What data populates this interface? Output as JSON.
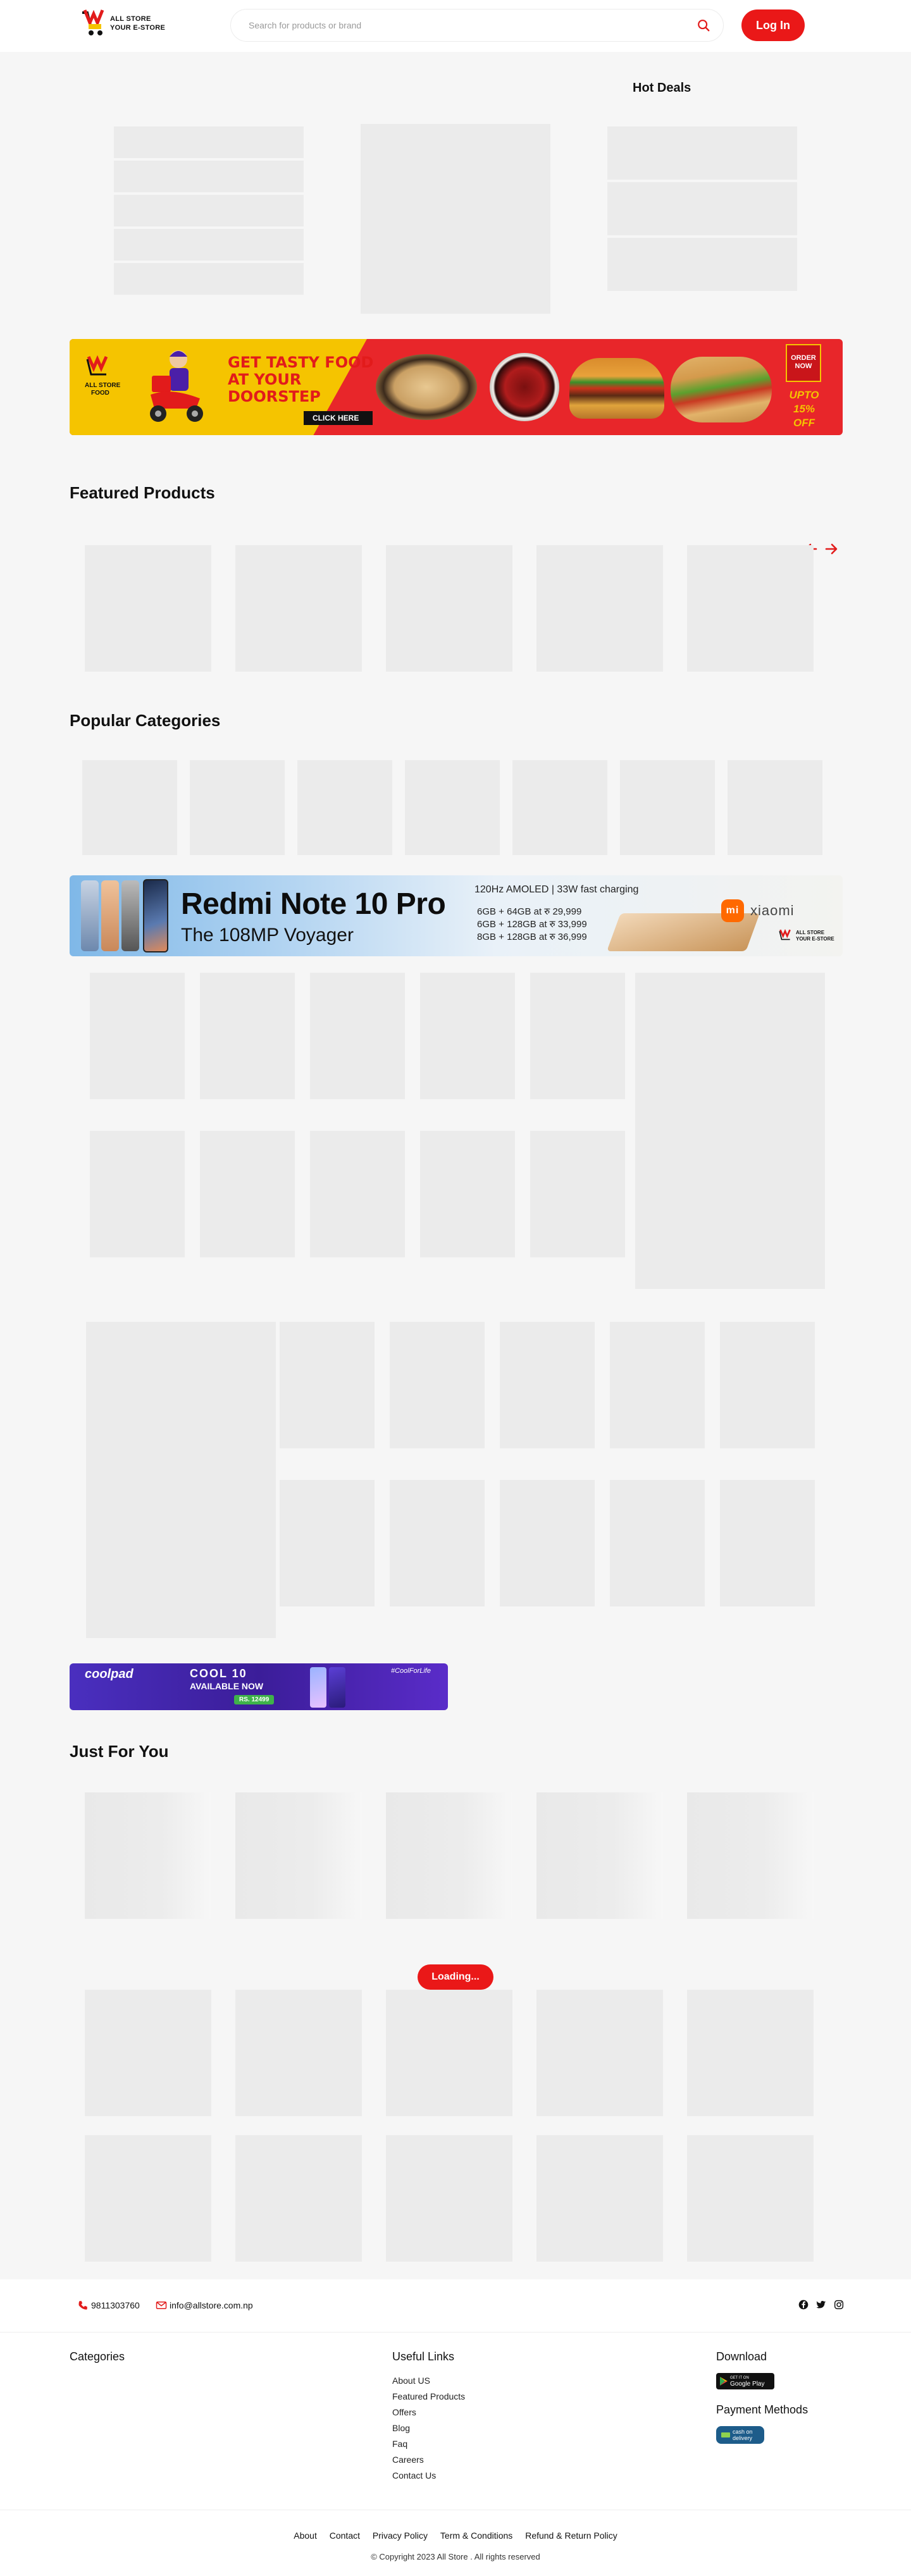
{
  "header": {
    "logo_line1": "ALL STORE",
    "logo_line2": "YOUR E-STORE",
    "search_placeholder": "Search for products or brand",
    "login_label": "Log In"
  },
  "hot_deals": {
    "title": "Hot Deals"
  },
  "food_banner": {
    "logo_line1": "ALL STORE",
    "logo_line2": "FOOD",
    "headline_1": "GET TASTY FOOD",
    "headline_2": "AT YOUR",
    "headline_3": "DOORSTEP",
    "cta": "CLICK HERE",
    "order_1": "ORDER",
    "order_2": "NOW",
    "discount_1": "UPTO",
    "discount_2": "15% OFF"
  },
  "featured": {
    "title": "Featured Products"
  },
  "popular": {
    "title": "Popular Categories"
  },
  "redmi_banner": {
    "title": "Redmi Note 10 Pro",
    "subtitle": "The 108MP Voyager",
    "spec": "120Hz AMOLED | 33W fast charging",
    "price_1": "6GB + 64GB at रु 29,999",
    "price_2": "6GB + 128GB at रु 33,999",
    "price_3": "8GB + 128GB at रु 36,999",
    "brand": "xiaomi",
    "mi": "mi",
    "store_line1": "ALL STORE",
    "store_line2": "YOUR E-STORE"
  },
  "coolpad_banner": {
    "brand": "coolpad",
    "model": "COOL 10",
    "availability": "AVAILABLE NOW",
    "price": "RS. 12499",
    "tag": "#CoolForLife"
  },
  "just_for_you": {
    "title": "Just For You",
    "loading_label": "Loading..."
  },
  "footer": {
    "phone": "9811303760",
    "email": "info@allstore.com.np",
    "categories_title": "Categories",
    "useful_links_title": "Useful Links",
    "useful_links": [
      "About US",
      "Featured Products",
      "Offers",
      "Blog",
      "Faq",
      "Careers",
      "Contact Us"
    ],
    "download_title": "Download",
    "google_play_small": "GET IT ON",
    "google_play": "Google Play",
    "payment_title": "Payment Methods",
    "payment_method_1": "cash on",
    "payment_method_2": "delivery",
    "bottom_links": [
      "About",
      "Contact",
      "Privacy Policy",
      "Term & Conditions",
      "Refund & Return Policy"
    ],
    "copyright": "© Copyright 2023 All Store . All rights reserved"
  },
  "colors": {
    "accent": "#ea1818",
    "placeholder": "#ebebeb",
    "background": "#f6f6f6"
  }
}
